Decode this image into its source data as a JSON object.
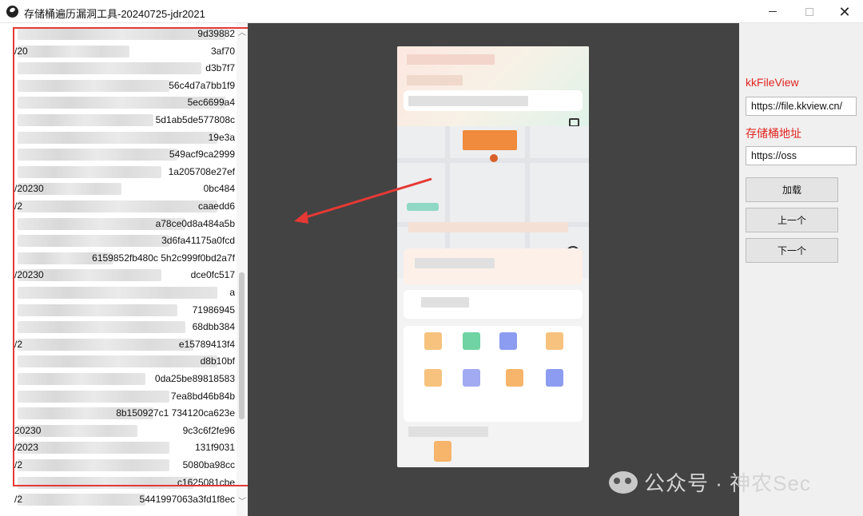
{
  "window": {
    "title": "存储桶遍历漏洞工具-20240725-jdr2021",
    "controls": {
      "minimize": "minimize-icon",
      "maximize": "maximize-icon",
      "close": "close-icon"
    }
  },
  "file_list": {
    "rows": [
      {
        "prefix": "",
        "suffix": "9d39882"
      },
      {
        "prefix": "/20",
        "suffix": "3af70"
      },
      {
        "prefix": "",
        "suffix": "d3b7f7"
      },
      {
        "prefix": "",
        "suffix": "56c4d7a7bb1f9"
      },
      {
        "prefix": "",
        "suffix": "5ec6699a4"
      },
      {
        "prefix": "",
        "suffix": "5d1ab5de577808c"
      },
      {
        "prefix": "",
        "suffix": "19e3a"
      },
      {
        "prefix": "",
        "suffix": "549acf9ca2999"
      },
      {
        "prefix": "",
        "suffix": "1a205708e27ef"
      },
      {
        "prefix": "/20230",
        "suffix": "0bc484"
      },
      {
        "prefix": "/2",
        "suffix": "caaedd6"
      },
      {
        "prefix": "",
        "suffix": "a78ce0d8a484a5b"
      },
      {
        "prefix": "",
        "suffix": "3d6fa41175a0fcd"
      },
      {
        "prefix": "",
        "suffix": "6159852fb480c 5h2c999f0bd2a7f"
      },
      {
        "prefix": "/20230",
        "suffix": "dce0fc517"
      },
      {
        "prefix": "",
        "suffix": "a"
      },
      {
        "prefix": "",
        "suffix": "71986945"
      },
      {
        "prefix": "",
        "suffix": "68dbb384"
      },
      {
        "prefix": "/2",
        "suffix": "e15789413f4"
      },
      {
        "prefix": "",
        "suffix": "d8b10bf"
      },
      {
        "prefix": "",
        "suffix": "0da25be89818583"
      },
      {
        "prefix": "",
        "suffix": "7ea8bd46b84b"
      },
      {
        "prefix": "",
        "suffix": "8b150927c1   734120ca623e"
      },
      {
        "prefix": "20230",
        "suffix": "9c3c6f2fe96"
      },
      {
        "prefix": "/2023",
        "suffix": "131f9031"
      },
      {
        "prefix": "/2",
        "suffix": "5080ba98cc"
      },
      {
        "prefix": "",
        "suffix": "c1625081cbe"
      },
      {
        "prefix": "/2",
        "suffix": "5441997063a3fd1f8ec"
      }
    ],
    "scroll_up_icon": "scroll-up-arrow-icon",
    "scroll_down_icon": "scroll-down-arrow-icon"
  },
  "viewer": {
    "annotation_color": "#e53935",
    "arrow_icon": "red-arrow-icon",
    "locate_icon": "locate-icon",
    "message_icon": "message-icon"
  },
  "controls": {
    "kkfileview_label": "kkFileView",
    "kkfileview_value": "https://file.kkview.cn/",
    "bucket_label": "存储桶地址",
    "bucket_value": "https://oss",
    "load_button": "加载",
    "prev_button": "上一个",
    "next_button": "下一个",
    "label_color": "#e0251f"
  },
  "watermark": {
    "text": "公众号 · 神农Sec",
    "icon": "wechat-logo-icon"
  }
}
